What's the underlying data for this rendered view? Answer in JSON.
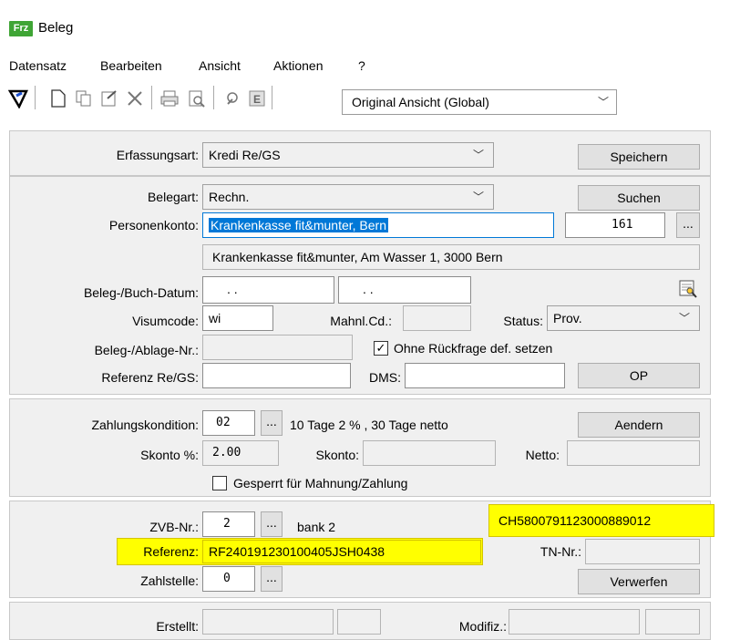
{
  "window": {
    "title": "Beleg",
    "app_icon_text": "Frz"
  },
  "menu": [
    "Datensatz",
    "Bearbeiten",
    "Ansicht",
    "Aktionen",
    "?"
  ],
  "toolbar": {
    "icons": [
      "filter-icon",
      "new-document-icon",
      "copy-icon",
      "properties-icon",
      "delete-icon",
      "print-icon",
      "print-preview-icon",
      "tool-icon",
      "e-icon"
    ],
    "view_select": "Original Ansicht (Global)"
  },
  "section1": {
    "erfassungsart_label": "Erfassungsart:",
    "erfassungsart_value": "Kredi Re/GS",
    "speichern_label": "Speichern"
  },
  "section2": {
    "belegart_label": "Belegart:",
    "belegart_value": "Rechn.",
    "suchen_label": "Suchen",
    "personenkonto_label": "Personenkonto:",
    "personenkonto_value": "Krankenkasse fit&munter, Bern",
    "konto_number": "161",
    "ellipsis": "...",
    "address": "Krankenkasse fit&munter, Am Wasser 1, 3000 Bern",
    "datum_label": "Beleg-/Buch-Datum:",
    "datum1": ".   .",
    "datum2": ".   .",
    "visumcode_label": "Visumcode:",
    "visumcode_value": "wi",
    "mahnl_label": "Mahnl.Cd.:",
    "status_label": "Status:",
    "status_value": "Prov.",
    "ablage_label": "Beleg-/Ablage-Nr.:",
    "ohne_rueckfrage_label": "Ohne Rückfrage def. setzen",
    "referenz_label": "Referenz Re/GS:",
    "dms_label": "DMS:",
    "op_label": "OP"
  },
  "section3": {
    "zahlungskondition_label": "Zahlungskondition:",
    "zahlungskondition_value": "02",
    "zahlungskondition_text": "10 Tage 2 % , 30 Tage netto",
    "aendern_label": "Aendern",
    "skonto_pct_label": "Skonto %:",
    "skonto_pct_value": "2.00",
    "skonto_label": "Skonto:",
    "netto_label": "Netto:",
    "gesperrt_label": "Gesperrt für Mahnung/Zahlung"
  },
  "section4": {
    "zvb_label": "ZVB-Nr.:",
    "zvb_value": "2",
    "zvb_text": "bank 2",
    "iban_value": "CH5800791123000889012",
    "referenz_label": "Referenz:",
    "referenz_value": "RF240191230100405JSH0438",
    "tn_label": "TN-Nr.:",
    "zahlstelle_label": "Zahlstelle:",
    "zahlstelle_value": "0",
    "verwerfen_label": "Verwerfen"
  },
  "section5": {
    "erstellt_label": "Erstellt:",
    "modifiz_label": "Modifiz.:"
  },
  "colors": {
    "highlight": "#ffff00",
    "selection": "#0078d7",
    "title_accent": "#4caf50"
  }
}
